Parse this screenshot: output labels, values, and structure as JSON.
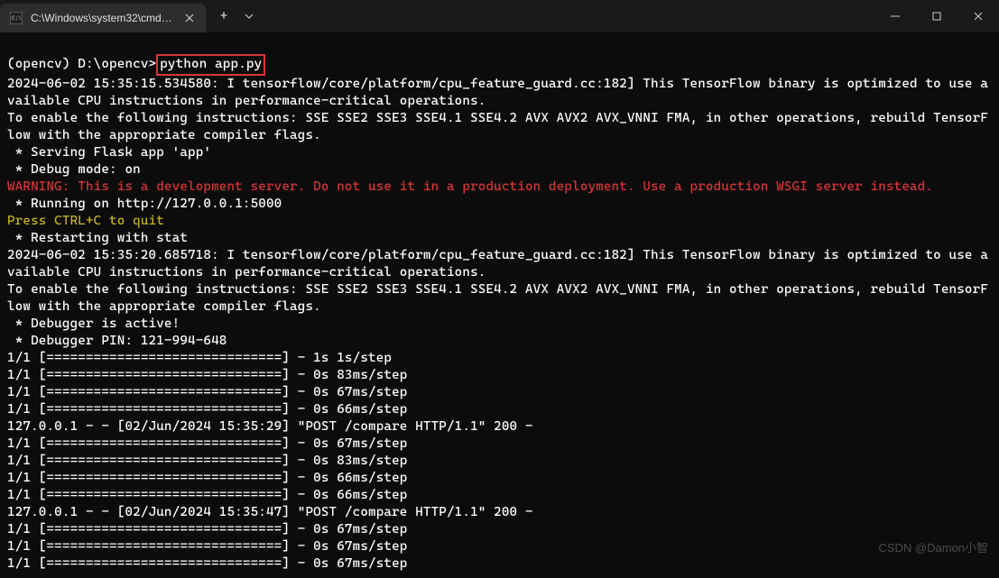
{
  "window": {
    "tab_title": "C:\\Windows\\system32\\cmd.ex",
    "new_tab": "+",
    "dropdown": "⌄"
  },
  "prompt": {
    "env": "(opencv) ",
    "path": "D:\\opencv>",
    "command": "python app.py"
  },
  "lines": {
    "l1": "2024-06-02 15:35:15.534580: I tensorflow/core/platform/cpu_feature_guard.cc:182] This TensorFlow binary is optimized to use available CPU instructions in performance-critical operations.",
    "l2": "To enable the following instructions: SSE SSE2 SSE3 SSE4.1 SSE4.2 AVX AVX2 AVX_VNNI FMA, in other operations, rebuild TensorFlow with the appropriate compiler flags.",
    "l3": " * Serving Flask app 'app'",
    "l4": " * Debug mode: on",
    "l5": "WARNING: This is a development server. Do not use it in a production deployment. Use a production WSGI server instead.",
    "l6": " * Running on http://127.0.0.1:5000",
    "l7": "Press CTRL+C to quit",
    "l8": " * Restarting with stat",
    "l9": "2024-06-02 15:35:20.685718: I tensorflow/core/platform/cpu_feature_guard.cc:182] This TensorFlow binary is optimized to use available CPU instructions in performance-critical operations.",
    "l10": "To enable the following instructions: SSE SSE2 SSE3 SSE4.1 SSE4.2 AVX AVX2 AVX_VNNI FMA, in other operations, rebuild TensorFlow with the appropriate compiler flags.",
    "l11": " * Debugger is active!",
    "l12": " * Debugger PIN: 121-994-648",
    "l13": "1/1 [==============================] - 1s 1s/step",
    "l14": "1/1 [==============================] - 0s 83ms/step",
    "l15": "1/1 [==============================] - 0s 67ms/step",
    "l16": "1/1 [==============================] - 0s 66ms/step",
    "l17": "127.0.0.1 - - [02/Jun/2024 15:35:29] \"POST /compare HTTP/1.1\" 200 -",
    "l18": "1/1 [==============================] - 0s 67ms/step",
    "l19": "1/1 [==============================] - 0s 83ms/step",
    "l20": "1/1 [==============================] - 0s 66ms/step",
    "l21": "1/1 [==============================] - 0s 66ms/step",
    "l22": "127.0.0.1 - - [02/Jun/2024 15:35:47] \"POST /compare HTTP/1.1\" 200 -",
    "l23": "1/1 [==============================] - 0s 67ms/step",
    "l24": "1/1 [==============================] - 0s 67ms/step",
    "l25": "1/1 [==============================] - 0s 67ms/step"
  },
  "watermark": "CSDN @Damon小智"
}
